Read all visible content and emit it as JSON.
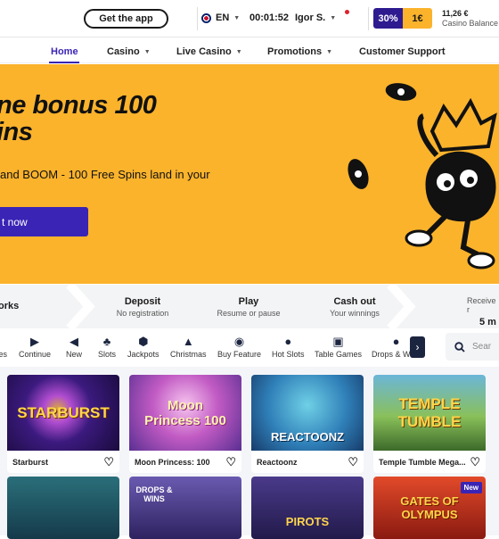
{
  "topbar": {
    "get_app": "Get the app",
    "language": "EN",
    "clock": "00:01:52",
    "user": "Igor S.",
    "bonus_pct": "30%",
    "bonus_amt": "1€",
    "balance_value": "11,26 €",
    "balance_label": "Casino Balance"
  },
  "nav": {
    "home": "Home",
    "casino": "Casino",
    "live_casino": "Live Casino",
    "promotions": "Promotions",
    "support": "Customer Support"
  },
  "hero": {
    "title_line1": "ne bonus 100",
    "title_line2": "ins",
    "subtitle": "and BOOM - 100 Free Spins land in your",
    "cta": "t now"
  },
  "steps": [
    {
      "title": "orks",
      "sub": ""
    },
    {
      "title": "Deposit",
      "sub": "No registration"
    },
    {
      "title": "Play",
      "sub": "Resume or pause"
    },
    {
      "title": "Cash out",
      "sub": "Your winnings"
    },
    {
      "title": "5 m",
      "sub": "Receive r"
    }
  ],
  "categories": [
    {
      "label": "tes",
      "icon": "clock-icon"
    },
    {
      "label": "Continue",
      "icon": "play-icon"
    },
    {
      "label": "New",
      "icon": "megaphone-icon"
    },
    {
      "label": "Slots",
      "icon": "cherry-icon"
    },
    {
      "label": "Jackpots",
      "icon": "coin-icon"
    },
    {
      "label": "Christmas",
      "icon": "tree-icon"
    },
    {
      "label": "Buy Feature",
      "icon": "target-icon"
    },
    {
      "label": "Hot Slots",
      "icon": "flame-icon"
    },
    {
      "label": "Table Games",
      "icon": "cards-icon"
    },
    {
      "label": "Drops & Wins",
      "icon": "bomb-icon"
    }
  ],
  "search": {
    "placeholder": "Sear"
  },
  "games": [
    {
      "name": "Starburst",
      "art": "STARBURST",
      "color": "#2a1063"
    },
    {
      "name": "Moon Princess: 100",
      "art": "Moon Princess 100",
      "color": "#b43a9e"
    },
    {
      "name": "Reactoonz",
      "art": "REACTOONZ",
      "color": "#1f6a9a"
    },
    {
      "name": "Temple Tumble Mega...",
      "art": "TEMPLE TUMBLE",
      "color": "#2f6b38"
    }
  ],
  "games_row2": [
    {
      "art": "",
      "color": "#1d4a5a"
    },
    {
      "art": "DROPS & WINS",
      "color": "#4a3580"
    },
    {
      "art": "PIROTS",
      "color": "#3a2a6a"
    },
    {
      "art": "GATES OF OLYMPUS",
      "color": "#d2331d",
      "badge": "New"
    }
  ]
}
